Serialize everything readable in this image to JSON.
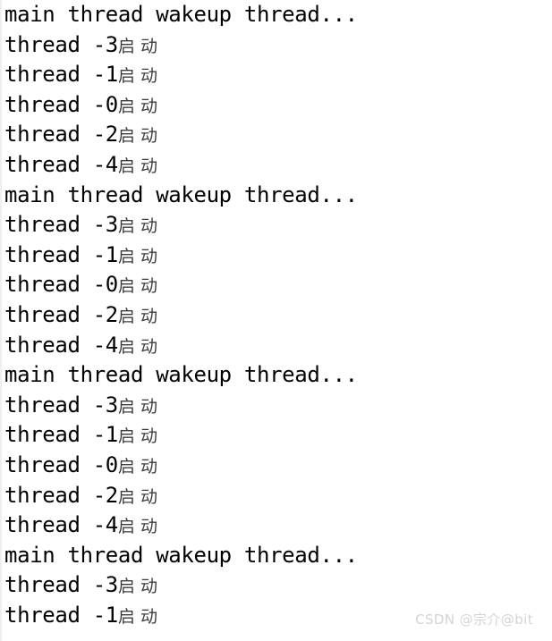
{
  "console": {
    "kind": "terminal-output",
    "background_color": "#ffffff",
    "text_color": "#000000",
    "cjk_text_color": "#3c3c3c",
    "border_color": "#f0efed",
    "line_count": 21,
    "wakeup_message": "main thread wakeup thread...",
    "thread_prefix": "thread ",
    "thread_suffix_cjk": "启 动",
    "thread_order": [
      "3",
      "1",
      "0",
      "2",
      "4"
    ],
    "lines": [
      {
        "text": "main thread wakeup thread...",
        "cjk": ""
      },
      {
        "text": "thread -3",
        "cjk": "启 动"
      },
      {
        "text": "thread -1",
        "cjk": "启 动"
      },
      {
        "text": "thread -0",
        "cjk": "启 动"
      },
      {
        "text": "thread -2",
        "cjk": "启 动"
      },
      {
        "text": "thread -4",
        "cjk": "启 动"
      },
      {
        "text": "main thread wakeup thread...",
        "cjk": ""
      },
      {
        "text": "thread -3",
        "cjk": "启 动"
      },
      {
        "text": "thread -1",
        "cjk": "启 动"
      },
      {
        "text": "thread -0",
        "cjk": "启 动"
      },
      {
        "text": "thread -2",
        "cjk": "启 动"
      },
      {
        "text": "thread -4",
        "cjk": "启 动"
      },
      {
        "text": "main thread wakeup thread...",
        "cjk": ""
      },
      {
        "text": "thread -3",
        "cjk": "启 动"
      },
      {
        "text": "thread -1",
        "cjk": "启 动"
      },
      {
        "text": "thread -0",
        "cjk": "启 动"
      },
      {
        "text": "thread -2",
        "cjk": "启 动"
      },
      {
        "text": "thread -4",
        "cjk": "启 动"
      },
      {
        "text": "main thread wakeup thread...",
        "cjk": ""
      },
      {
        "text": "thread -3",
        "cjk": "启 动"
      },
      {
        "text": "thread -1",
        "cjk": "启 动"
      }
    ]
  },
  "watermark": {
    "text": "CSDN @宗介@bit",
    "color": "#d4d4d4"
  }
}
